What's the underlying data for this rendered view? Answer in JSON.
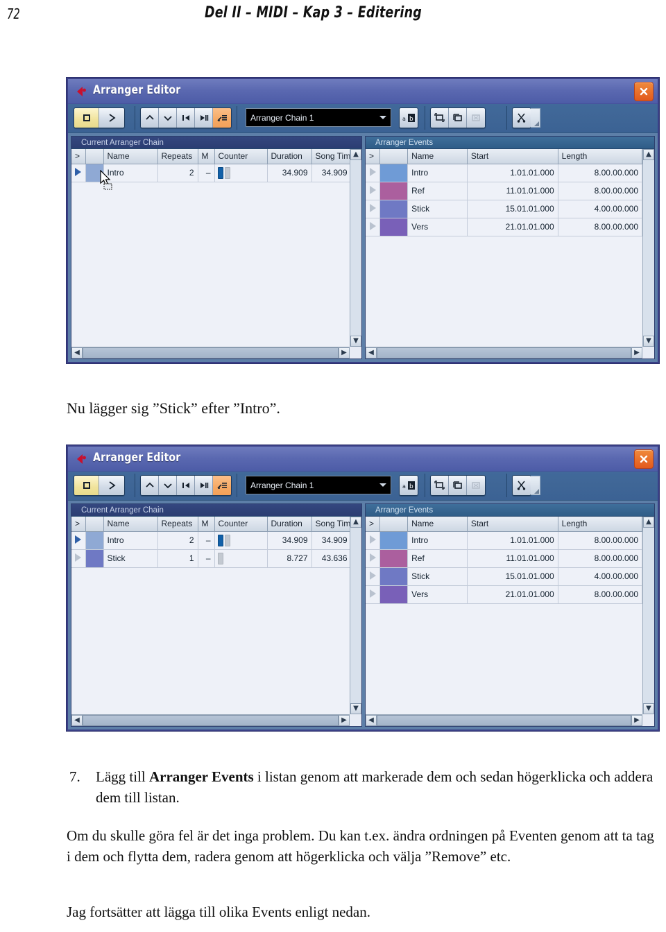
{
  "page": {
    "number": "72",
    "running_head": "Del II – MIDI – Kap 3 – Editering"
  },
  "window": {
    "title": "Arranger Editor",
    "close_icon": "close-x-icon",
    "toolbar": {
      "stop_icon": "stop-icon",
      "play_icon": "play-icon",
      "up_icon": "arrow-up-icon",
      "down_icon": "arrow-down-icon",
      "prev_icon": "skip-to-start-icon",
      "next_icon": "skip-forward-pause-icon",
      "mode_icon": "arranger-mode-icon",
      "chain_value": "Arranger Chain 1",
      "rename_icon": "ab-rename-icon",
      "new_icon": "new-chain-icon",
      "duplicate_icon": "duplicate-chain-icon",
      "delete_icon": "delete-chain-icon",
      "flatten_icon": "flatten-scissors-icon"
    }
  },
  "left_panel": {
    "title": "Current Arranger Chain",
    "columns": [
      ">",
      "",
      "Name",
      "Repeats",
      "M",
      "Counter",
      "Duration",
      "Song Time"
    ]
  },
  "right_panel": {
    "title": "Arranger Events",
    "columns": [
      ">",
      "",
      "Name",
      "Start",
      "Length"
    ],
    "rows": [
      {
        "name": "Intro",
        "start": "1.01.01.000",
        "length": "8.00.00.000",
        "color": "#6f9bd6",
        "selected": false
      },
      {
        "name": "Ref",
        "start": "11.01.01.000",
        "length": "8.00.00.000",
        "color": "#ab5f9e",
        "selected": false
      },
      {
        "name": "Stick",
        "start": "15.01.01.000",
        "length": "4.00.00.000",
        "color": "#6f79c4",
        "selected": true
      },
      {
        "name": "Vers",
        "start": "21.01.01.000",
        "length": "8.00.00.000",
        "color": "#7960b8",
        "selected": false
      }
    ]
  },
  "figure1": {
    "chain_rows": [
      {
        "name": "Intro",
        "repeats": "2",
        "m": "–",
        "counter_on": 1,
        "counter_off": 1,
        "duration": "34.909",
        "song_time": "34.909",
        "active": true,
        "swatch": "#8fa9d4"
      }
    ]
  },
  "figure2": {
    "chain_rows": [
      {
        "name": "Intro",
        "repeats": "2",
        "m": "–",
        "counter_on": 1,
        "counter_off": 1,
        "duration": "34.909",
        "song_time": "34.909",
        "active": true,
        "swatch": "#8fa9d4"
      },
      {
        "name": "Stick",
        "repeats": "1",
        "m": "–",
        "counter_on": 0,
        "counter_off": 1,
        "duration": "8.727",
        "song_time": "43.636",
        "active": false,
        "swatch": "#6f79c4"
      }
    ]
  },
  "text": {
    "caption1": "Nu lägger sig ”Stick” efter ”Intro”.",
    "step_number": "7.",
    "step_part1": "Lägg till ",
    "step_bold": "Arranger Events",
    "step_part2": " i listan genom att markerade dem och sedan högerklicka och addera dem till listan.",
    "para2": "Om du skulle göra fel är det inga problem. Du kan t.ex. ändra ordningen på Eventen genom att ta tag i dem och flytta dem, radera genom att högerklicka och välja ”Remove” etc.",
    "para3": "Jag fortsätter att lägga till olika Events enligt nedan."
  }
}
